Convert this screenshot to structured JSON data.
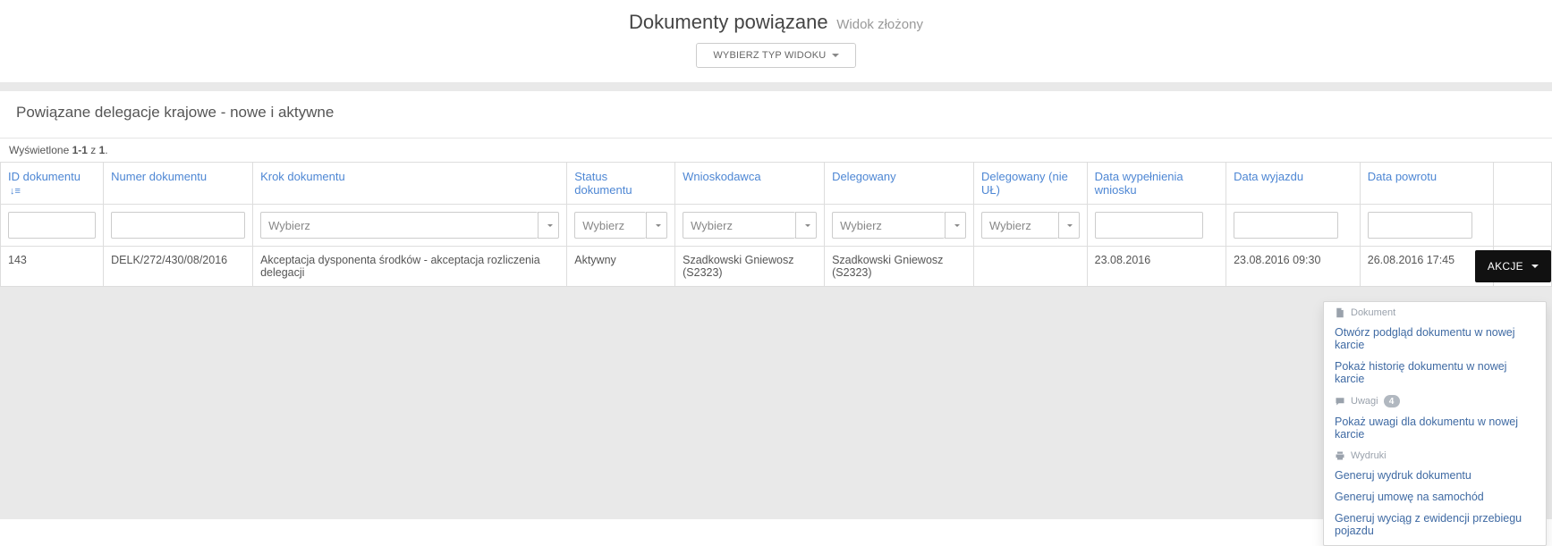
{
  "header": {
    "title": "Dokumenty powiązane",
    "subtitle": "Widok złożony",
    "view_button": "WYBIERZ TYP WIDOKU"
  },
  "section": {
    "title": "Powiązane delegacje krajowe - nowe i aktywne"
  },
  "summary": {
    "prefix": "Wyświetlone ",
    "range": "1-1",
    "of": " z ",
    "total": "1",
    "suffix": "."
  },
  "columns": {
    "id": "ID dokumentu",
    "numer": "Numer dokumentu",
    "krok": "Krok dokumentu",
    "status": "Status dokumentu",
    "wnioskodawca": "Wnioskodawca",
    "delegowany": "Delegowany",
    "delegowany_nie": "Delegowany (nie UŁ)",
    "data_wyp": "Data wypełnienia wniosku",
    "data_wyj": "Data wyjazdu",
    "data_pow": "Data powrotu"
  },
  "filters": {
    "placeholder_select": "Wybierz"
  },
  "row": {
    "id": "143",
    "numer": "DELK/272/430/08/2016",
    "krok": "Akceptacja dysponenta środków - akceptacja rozliczenia delegacji",
    "status": "Aktywny",
    "wnioskodawca": "Szadkowski Gniewosz (S2323)",
    "delegowany": "Szadkowski Gniewosz (S2323)",
    "delegowany_nie": "",
    "data_wyp": "23.08.2016",
    "data_wyj": "23.08.2016 09:30",
    "data_pow": "26.08.2016 17:45"
  },
  "actions": {
    "button": "AKCJE",
    "headers": {
      "dokument": "Dokument",
      "uwagi": "Uwagi",
      "wydruki": "Wydruki"
    },
    "badge": "4",
    "items": {
      "a1": "Otwórz podgląd dokumentu w nowej karcie",
      "a2": "Pokaż historię dokumentu w nowej karcie",
      "b1": "Pokaż uwagi dla dokumentu w nowej karcie",
      "c1": "Generuj wydruk dokumentu",
      "c2": "Generuj umowę na samochód",
      "c3": "Generuj wyciąg z ewidencji przebiegu pojazdu"
    }
  }
}
